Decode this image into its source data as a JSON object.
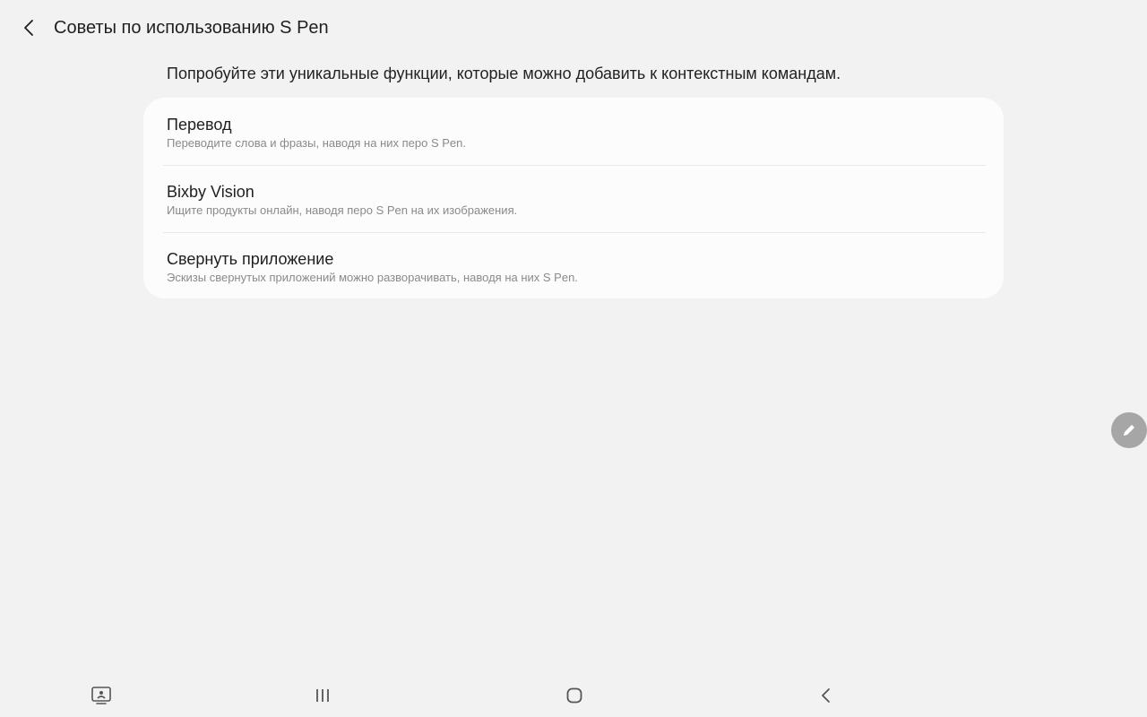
{
  "header": {
    "title": "Советы по использованию S Pen"
  },
  "intro": {
    "text": "Попробуйте эти уникальные функции, которые можно добавить к контекстным командам."
  },
  "items": [
    {
      "title": "Перевод",
      "subtitle": "Переводите слова и фразы, наводя на них перо S Pen."
    },
    {
      "title": "Bixby Vision",
      "subtitle": "Ищите продукты онлайн, наводя перо S Pen на их изображения."
    },
    {
      "title": "Свернуть приложение",
      "subtitle": "Эскизы свернутых приложений можно разворачивать, наводя на них S Pen."
    }
  ],
  "icons": {
    "back": "chevron-left-icon",
    "pen": "pencil-icon",
    "screenshot": "screenshot-keyboard-icon",
    "recents": "recents-icon",
    "home": "home-icon",
    "nav_back": "nav-back-icon"
  },
  "colors": {
    "background": "#f2f2f2",
    "card": "#fcfcfc",
    "fab": "#a6a6a6"
  }
}
